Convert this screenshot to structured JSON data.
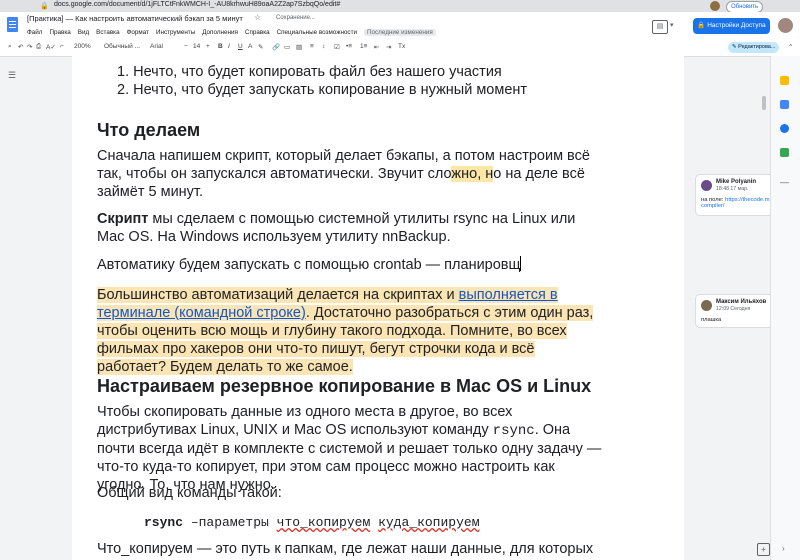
{
  "browser": {
    "url": "docs.google.com/document/d/1jFLTCtFnkWMCH-I_-AU8krhwuH89oaA2Z2ap7SzbqQo/edit#",
    "update_label": "Обновить"
  },
  "doc": {
    "title": "[Практика] — Как настроить автоматический бэкап за 5 минут",
    "saving": "Сохранение...",
    "menu": [
      "Файл",
      "Правка",
      "Вид",
      "Вставка",
      "Формат",
      "Инструменты",
      "Дополнения",
      "Справка",
      "Специальные возможности"
    ],
    "last_edit": "Последние изменения",
    "share_label": "Настройки Доступа",
    "mode_label": "Редактирова..."
  },
  "toolbar": {
    "zoom": "200%",
    "style": "Обычный ...",
    "font": "Arial",
    "size": "14"
  },
  "content": {
    "list_item_1": "1.  Нечто, что будет копировать файл без нашего участия",
    "list_item_2": "2.  Нечто, что будет запускать копирование в нужный момент",
    "heading_1": "Что делаем",
    "p1_a": "Сначала напишем скрипт, который делает бэкапы, а потом настроим всё так, чтобы он запускался автоматически. Звучит сло",
    "p1_hl": "жно, н",
    "p1_b": "о на деле всё займёт 5 минут.",
    "p2_bold": "Скрипт",
    "p2_rest": " мы сделаем с помощью системной утилиты rsync на Linux или Mac OS. На Windows используем утилиту nnBackup.",
    "p3": "Автоматику будем запускать с помощью crontab — планировщ",
    "p4_a": "Большинство автоматизаций делается на скриптах и ",
    "p4_link": "выполняется в терминале (командной строке)",
    "p4_b": ". Достаточно разобраться с этим один раз, чтобы оценить всю мощь и глубину такого подхода. Помните, во всех фильмах про хакеров они что-то пишут, бегут строчки кода и всё работает? Будем делать то же самое.",
    "heading_2": "Настраиваем резервное копирование в Mac OS и Linux",
    "p5_a": "Чтобы скопировать данные из одного места в другое, во всех дистрибутивах Linux, UNIX и Mac OS используют команду ",
    "p5_code": "rsync",
    "p5_b": ". Она почти всегда идёт в комплекте с системой и решает только одну задачу — что-то куда-то копирует, при этом сам процесс можно настроить как угодно. То, что нам нужно.",
    "p6": "Общий вид команды такой:",
    "code_cmd": "rsync",
    "code_params": " –параметры ",
    "code_what": "что_копируем",
    "code_where": "куда_копируем",
    "p7": "Что_копируем — это путь к папкам, где лежат наши данные, для которых мы"
  },
  "comments": [
    {
      "name": "Mike Polyanin",
      "time": "18:48 17 мар.",
      "text": "на поле: ",
      "link": "https://thecode.m",
      "text2": "compiler/"
    },
    {
      "name": "Максим Ильяхов",
      "time": "12:09 Сегодня",
      "text": "плашка"
    }
  ],
  "colors": {
    "highlight": "#fde7a7",
    "share_button": "#1a73e8",
    "link": "#1155cc"
  }
}
